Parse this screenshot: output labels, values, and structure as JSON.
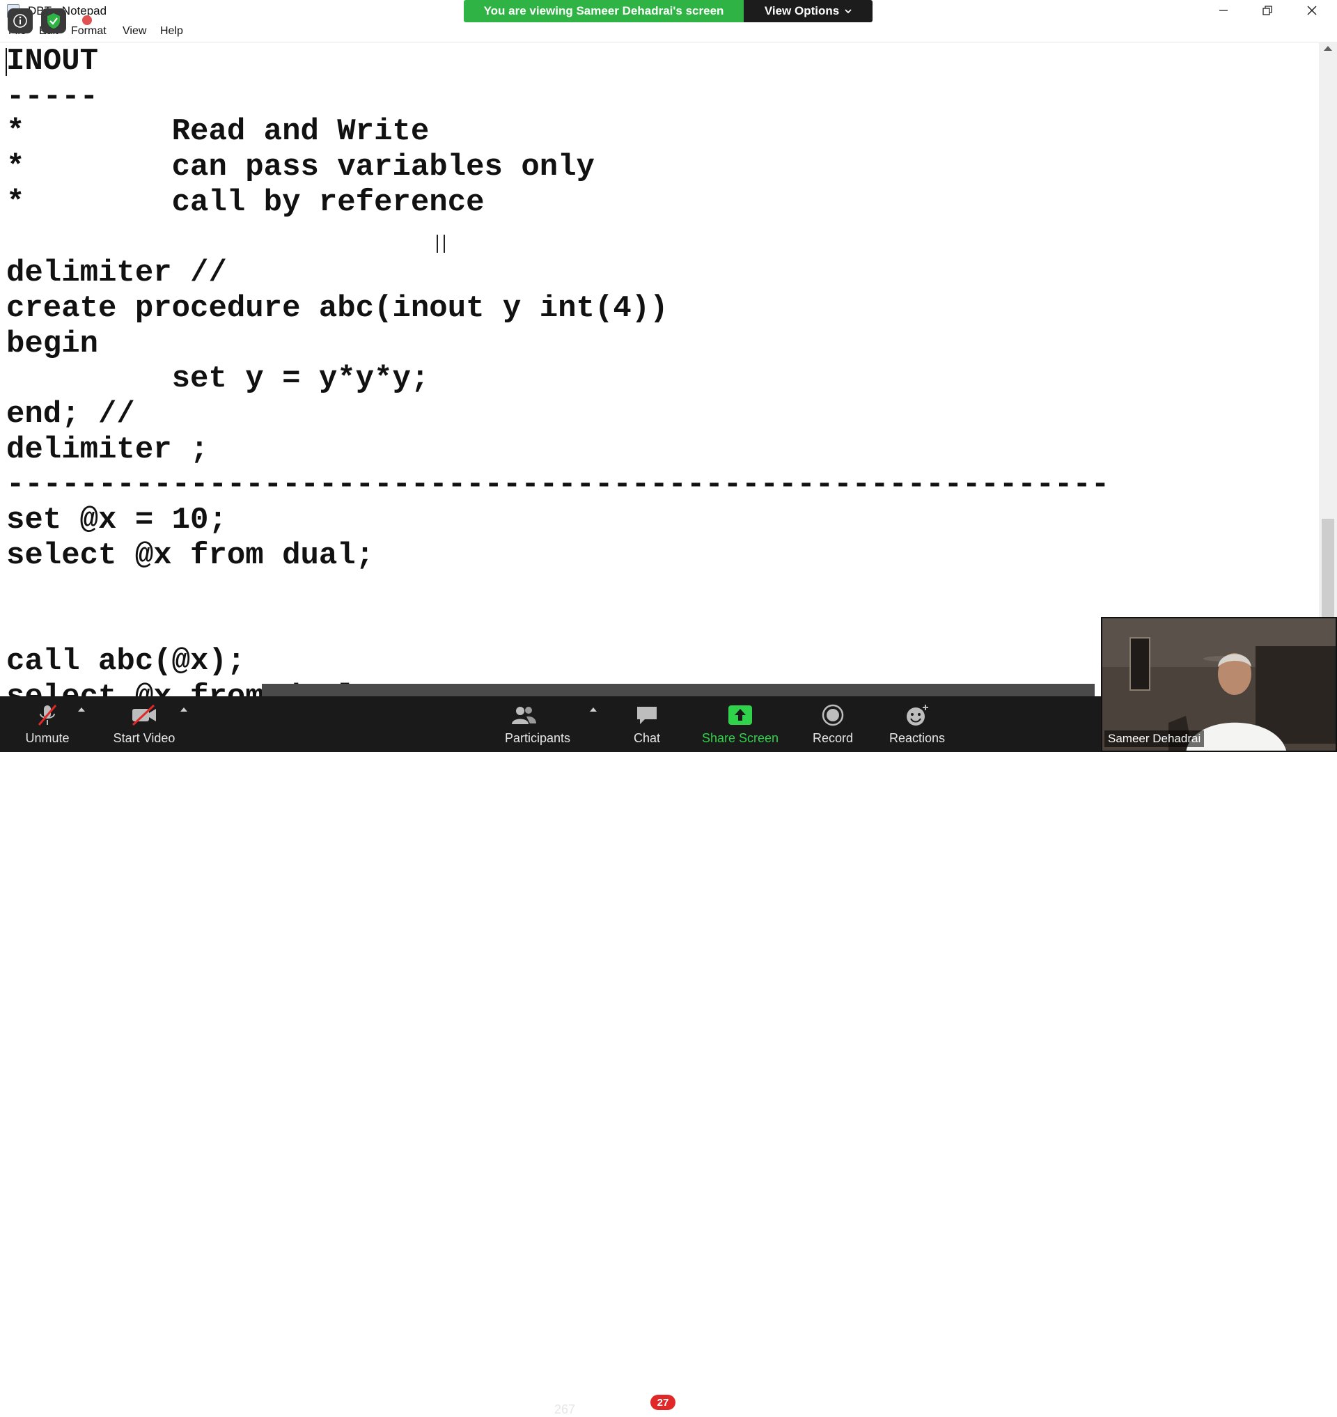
{
  "window": {
    "title": "DBT - Notepad",
    "menu": [
      "File",
      "Edit",
      "Format",
      "View",
      "Help"
    ]
  },
  "banner": {
    "text": "You are viewing Sameer Dehadrai's screen",
    "options_label": "View Options"
  },
  "editor": {
    "content": "INOUT\n-----\n*        Read and Write\n*        can pass variables only\n*        call by reference\n\ndelimiter //\ncreate procedure abc(inout y int(4))\nbegin\n         set y = y*y*y;\nend; //\ndelimiter ;\n------------------------------------------------------------\nset @x = 10;\nselect @x from dual;\n\n\ncall abc(@x);\nselect @x from dual;"
  },
  "toolbar": {
    "unmute": "Unmute",
    "start_video": "Start Video",
    "participants": "Participants",
    "participants_count": "267",
    "chat": "Chat",
    "chat_badge": "27",
    "share_screen": "Share Screen",
    "record": "Record",
    "reactions": "Reactions"
  },
  "video": {
    "name": "Sameer Dehadrai"
  },
  "colors": {
    "banner_green": "#2fb344",
    "toolbar_bg": "#1a1a1a",
    "share_green": "#2fd24a",
    "badge_red": "#e02828"
  }
}
